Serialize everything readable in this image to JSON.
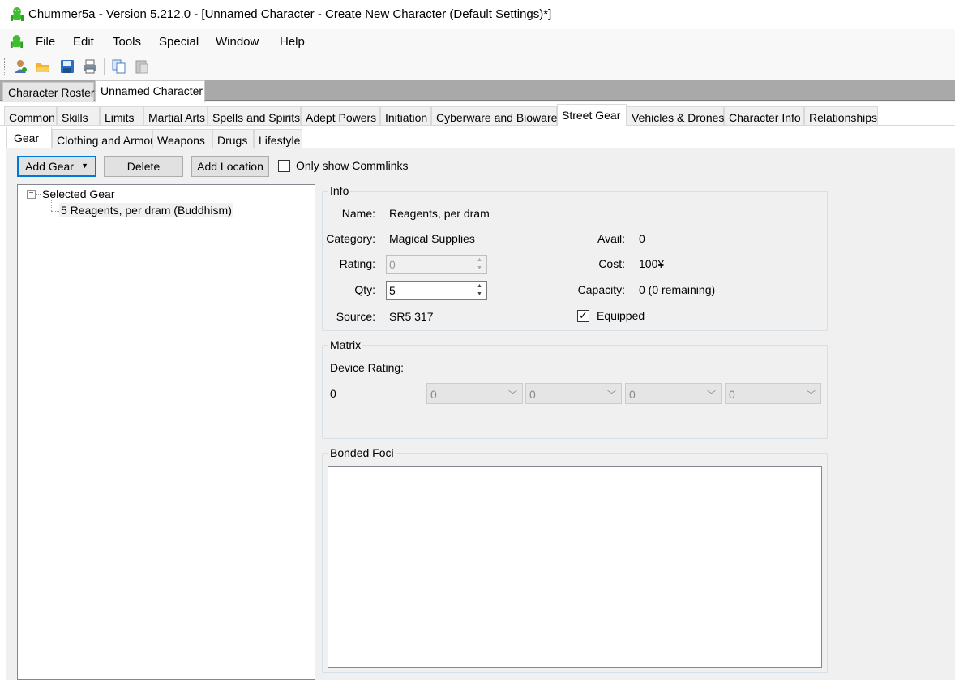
{
  "window": {
    "title": "Chummer5a - Version 5.212.0 - [Unnamed Character - Create New Character (Default Settings)*]"
  },
  "menu": {
    "items": [
      "File",
      "Edit",
      "Tools",
      "Special",
      "Window",
      "Help"
    ]
  },
  "toolbar": {
    "icons": [
      "new-character-icon",
      "open-folder-icon",
      "save-icon",
      "print-icon",
      "copy-icon",
      "paste-icon"
    ]
  },
  "doc_tabs": [
    "Character Roster",
    "Unnamed Character"
  ],
  "main_tabs": [
    "Common",
    "Skills",
    "Limits",
    "Martial Arts",
    "Spells and Spirits",
    "Adept Powers",
    "Initiation",
    "Cyberware and Bioware",
    "Street Gear",
    "Vehicles & Drones",
    "Character Info",
    "Relationships"
  ],
  "sub_tabs": [
    "Gear",
    "Clothing and Armor",
    "Weapons",
    "Drugs",
    "Lifestyle"
  ],
  "actions": {
    "add_gear": "Add Gear",
    "delete": "Delete",
    "add_location": "Add Location",
    "only_commlinks": "Only show Commlinks"
  },
  "tree": {
    "root": "Selected Gear",
    "child": "5 Reagents, per dram (Buddhism)"
  },
  "info": {
    "title": "Info",
    "name_label": "Name:",
    "name_value": "Reagents, per dram",
    "category_label": "Category:",
    "category_value": "Magical Supplies",
    "rating_label": "Rating:",
    "rating_value": "0",
    "qty_label": "Qty:",
    "qty_value": "5",
    "source_label": "Source:",
    "source_value": "SR5 317",
    "avail_label": "Avail:",
    "avail_value": "0",
    "cost_label": "Cost:",
    "cost_value": "100¥",
    "capacity_label": "Capacity:",
    "capacity_value": "0 (0 remaining)",
    "equipped_label": "Equipped"
  },
  "matrix": {
    "title": "Matrix",
    "device_rating_label": "Device Rating:",
    "device_rating_value": "0",
    "combos": [
      "0",
      "0",
      "0",
      "0"
    ]
  },
  "bonded_foci": {
    "title": "Bonded Foci"
  },
  "colors": {
    "accent": "#0078d7",
    "app_icon": "#3fbf2f"
  }
}
